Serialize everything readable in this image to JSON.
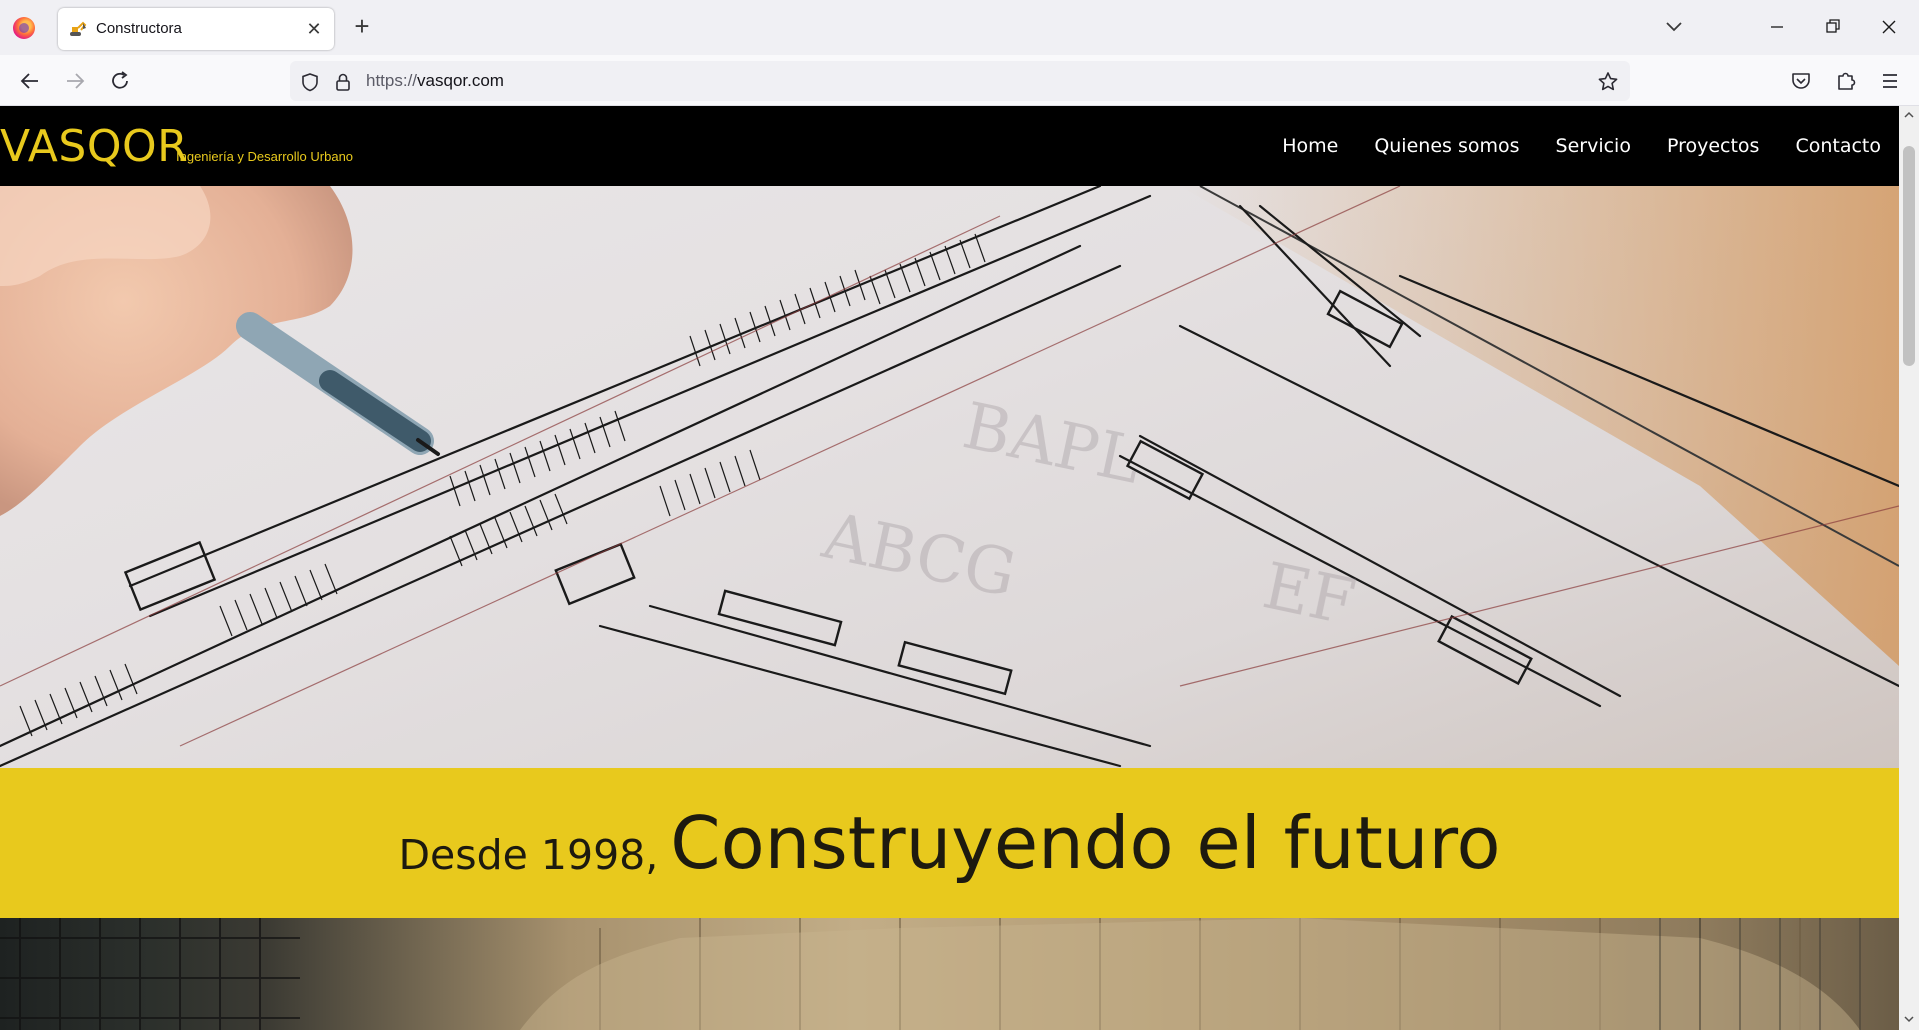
{
  "browser": {
    "tab_title": "Constructora",
    "url_scheme": "https://",
    "url_host": "vasqor.com"
  },
  "site": {
    "brand": "VASQOR",
    "tagline": "Ingeniería y Desarrollo Urbano",
    "menu": [
      {
        "label": "Home"
      },
      {
        "label": "Quienes somos"
      },
      {
        "label": "Servicio"
      },
      {
        "label": "Proyectos"
      },
      {
        "label": "Contacto"
      }
    ],
    "slogan_small": "Desde 1998,",
    "slogan_big": "Construyendo el futuro"
  },
  "colors": {
    "brand_yellow": "#e8c91d",
    "header_bg": "#000000",
    "band_bg": "#e8c91d"
  },
  "icons": {
    "browser_logo": "firefox-icon",
    "tab_favicon": "excavator-icon",
    "back": "arrow-left-icon",
    "forward": "arrow-right-icon",
    "reload": "reload-icon",
    "tracking": "shield-icon",
    "secure": "lock-icon",
    "bookmark": "star-icon",
    "pocket": "pocket-icon",
    "extensions": "puzzle-icon",
    "menu": "hamburger-icon"
  }
}
